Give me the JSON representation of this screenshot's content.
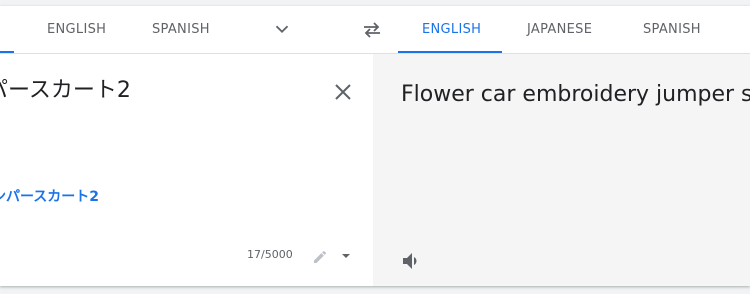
{
  "source_langs": {
    "tabs": [
      {
        "label": "ENGLISH"
      },
      {
        "label": "SPANISH"
      }
    ]
  },
  "target_langs": {
    "tabs": [
      {
        "label": "ENGLISH",
        "active": true
      },
      {
        "label": "JAPANESE"
      },
      {
        "label": "SPANISH"
      }
    ]
  },
  "source": {
    "text": "パースカート2",
    "suggestion": "ンパースカート2",
    "char_count": "17/5000"
  },
  "target": {
    "text": "Flower car embroidery jumper sk"
  },
  "icons": {
    "chevron": "chevron-down-icon",
    "swap": "swap-icon",
    "clear": "close-icon",
    "pencil": "pencil-icon",
    "caret": "caret-down-icon",
    "speaker": "speaker-icon"
  },
  "colors": {
    "accent": "#1a73e8",
    "text": "#202124",
    "muted": "#5f6368",
    "target_bg": "#f5f5f5"
  }
}
